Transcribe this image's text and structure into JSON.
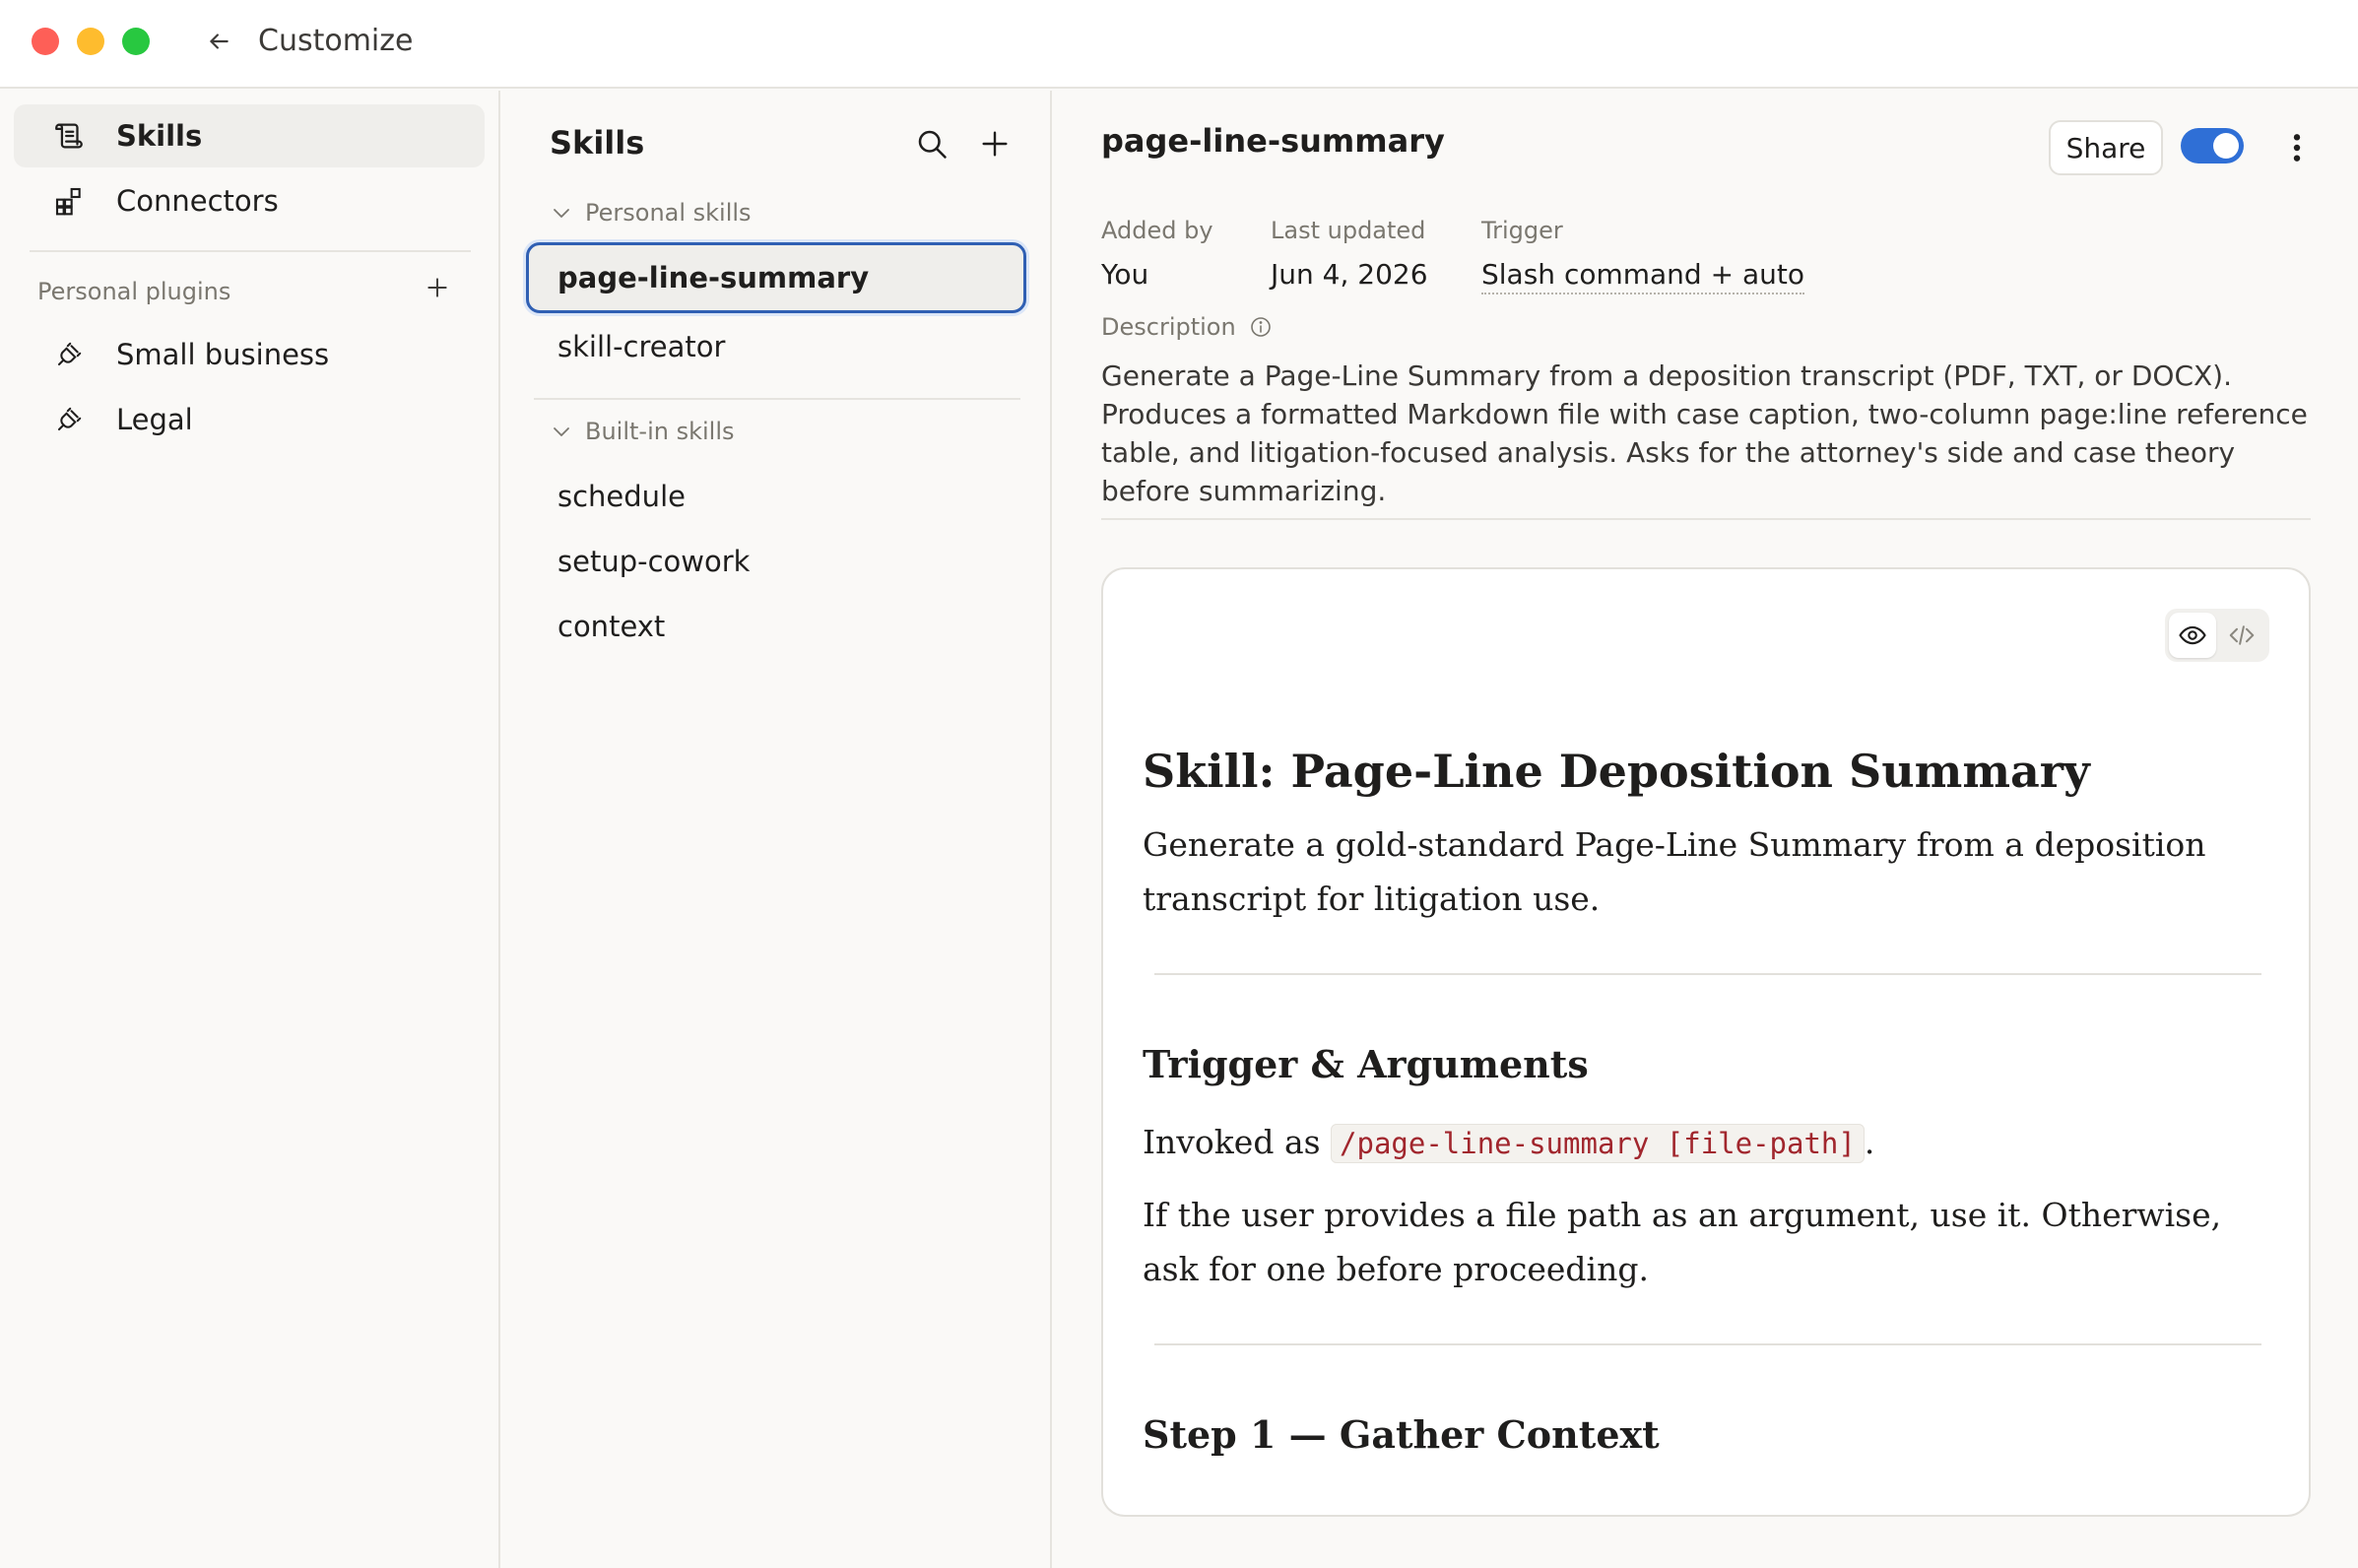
{
  "window": {
    "title": "Customize"
  },
  "nav": {
    "items": [
      {
        "label": "Skills",
        "icon": "skills-icon",
        "active": true
      },
      {
        "label": "Connectors",
        "icon": "connectors-icon",
        "active": false
      }
    ],
    "plugins_label": "Personal plugins",
    "plugins": [
      {
        "label": "Small business",
        "icon": "plug-icon"
      },
      {
        "label": "Legal",
        "icon": "plug-icon"
      }
    ]
  },
  "skills_panel": {
    "title": "Skills",
    "personal_label": "Personal skills",
    "personal": [
      "page-line-summary",
      "skill-creator"
    ],
    "builtin_label": "Built-in skills",
    "builtin": [
      "schedule",
      "setup-cowork",
      "context"
    ],
    "selected": "page-line-summary"
  },
  "detail": {
    "title": "page-line-summary",
    "share_label": "Share",
    "enabled": true,
    "meta": {
      "added_by_label": "Added by",
      "added_by": "You",
      "last_updated_label": "Last updated",
      "last_updated": "Jun 4, 2026",
      "trigger_label": "Trigger",
      "trigger": "Slash command + auto"
    },
    "description_label": "Description",
    "description": "Generate a Page-Line Summary from a deposition transcript (PDF, TXT, or DOCX). Produces a formatted Markdown file with case caption, two-column page:line reference table, and litigation-focused analysis. Asks for the attorney's side and case theory before summarizing."
  },
  "doc": {
    "h1": "Skill: Page-Line Deposition Summary",
    "p1": "Generate a gold-standard Page-Line Summary from a deposition transcript for litigation use.",
    "h2_trigger": "Trigger & Arguments",
    "invoked_prefix": "Invoked as ",
    "invoked_code": "/page-line-summary [file-path]",
    "invoked_suffix": ".",
    "p3": "If the user provides a file path as an argument, use it. Otherwise, ask for one before proceeding.",
    "h2_step1": "Step 1 — Gather Context"
  },
  "colors": {
    "accent": "#2f6fd6",
    "selection_border": "#2f5fb3",
    "code_text": "#a1262d"
  }
}
